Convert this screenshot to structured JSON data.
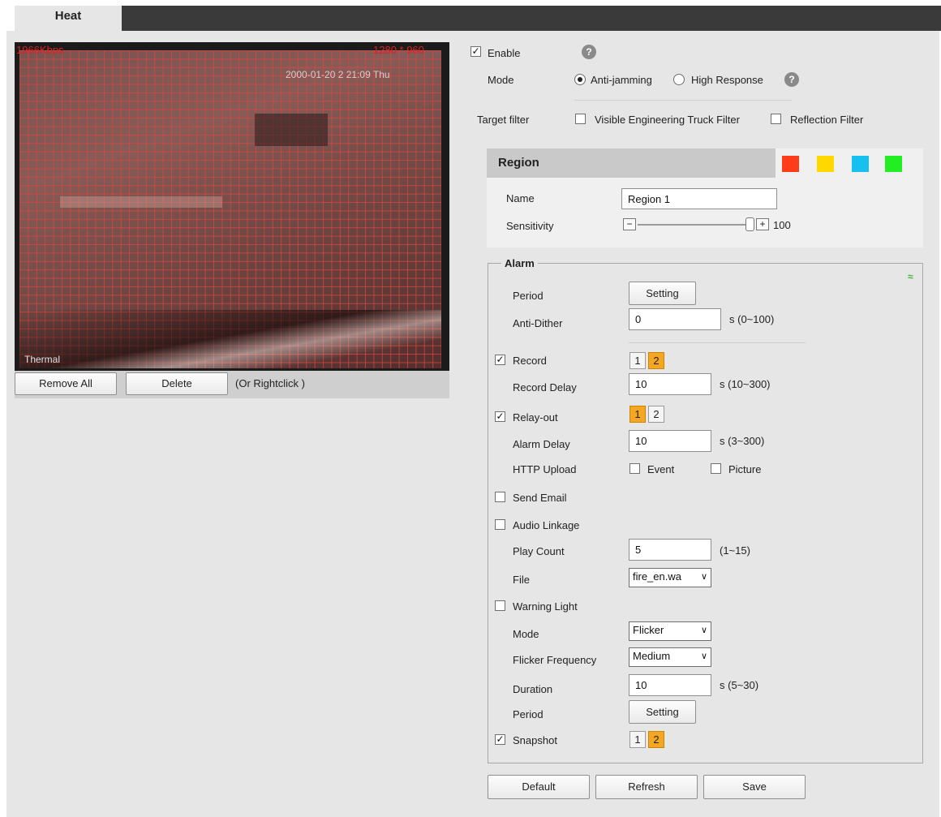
{
  "tab": {
    "label": "Heat"
  },
  "video": {
    "bitrate": "1966Kbps",
    "resolution": "1280 * 960",
    "timestamp": "2000-01-20 2  21:09 Thu",
    "channel_label": "Thermal"
  },
  "video_buttons": {
    "remove_all": "Remove All",
    "delete": "Delete",
    "hint": "(Or Rightclick )"
  },
  "enable": {
    "label": "Enable",
    "checked": true
  },
  "mode": {
    "label": "Mode",
    "option1": "Anti-jamming",
    "option2": "High Response",
    "selected": "Anti-jamming"
  },
  "target_filter": {
    "label": "Target filter",
    "option1": "Visible Engineering Truck Filter",
    "option2": "Reflection Filter"
  },
  "region": {
    "title": "Region",
    "name_label": "Name",
    "name_value": "Region 1",
    "sensitivity_label": "Sensitivity",
    "sensitivity_value": "100",
    "colors": [
      "#ff3c1a",
      "#ffd800",
      "#18c0f0",
      "#22ee22"
    ]
  },
  "alarm": {
    "legend": "Alarm",
    "period_label": "Period",
    "setting_label": "Setting",
    "anti_dither_label": "Anti-Dither",
    "anti_dither_value": "0",
    "anti_dither_range": "s (0~100)",
    "record_label": "Record",
    "record_channels": [
      "1",
      "2"
    ],
    "record_delay_label": "Record Delay",
    "record_delay_value": "10",
    "record_delay_range": "s (10~300)",
    "relay_label": "Relay-out",
    "relay_channels": [
      "1",
      "2"
    ],
    "alarm_delay_label": "Alarm Delay",
    "alarm_delay_value": "10",
    "alarm_delay_range": "s (3~300)",
    "http_upload_label": "HTTP Upload",
    "event_label": "Event",
    "picture_label": "Picture",
    "send_email_label": "Send Email",
    "audio_linkage_label": "Audio Linkage",
    "play_count_label": "Play Count",
    "play_count_value": "5",
    "play_count_range": "(1~15)",
    "file_label": "File",
    "file_value": "fire_en.wa",
    "warning_light_label": "Warning Light",
    "wl_mode_label": "Mode",
    "wl_mode_value": "Flicker",
    "flicker_label": "Flicker Frequency",
    "flicker_value": "Medium",
    "duration_label": "Duration",
    "duration_value": "10",
    "duration_range": "s (5~30)",
    "period2_label": "Period",
    "setting2_label": "Setting",
    "snapshot_label": "Snapshot",
    "snapshot_channels": [
      "1",
      "2"
    ]
  },
  "footer": {
    "default": "Default",
    "refresh": "Refresh",
    "save": "Save"
  },
  "check_mark": "✓",
  "help_glyph": "?",
  "collapse_glyph": "≈",
  "chevron_glyph": "∨",
  "minus_glyph": "−",
  "plus_glyph": "+"
}
